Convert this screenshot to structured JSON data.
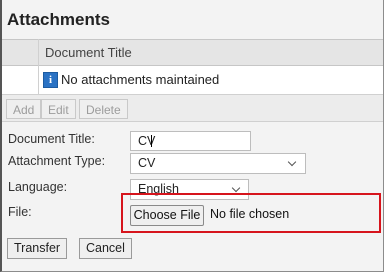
{
  "panel": {
    "title": "Attachments"
  },
  "table": {
    "columns": [
      "Document Title"
    ],
    "empty_message": "No attachments maintained"
  },
  "toolbar": {
    "add": "Add",
    "edit": "Edit",
    "delete": "Delete"
  },
  "form": {
    "document_title": {
      "label": "Document Title:",
      "value": "CV"
    },
    "attachment_type": {
      "label": "Attachment Type:",
      "value": "CV"
    },
    "language": {
      "label": "Language:",
      "value": "English"
    },
    "file": {
      "label": "File:",
      "button": "Choose File",
      "status": "No file chosen"
    }
  },
  "actions": {
    "transfer": "Transfer",
    "cancel": "Cancel"
  },
  "colors": {
    "highlight": "#d6141c",
    "info_icon": "#2a72c4"
  },
  "icons": {
    "info": "info-icon",
    "dropdown": "chevron-down-icon"
  }
}
